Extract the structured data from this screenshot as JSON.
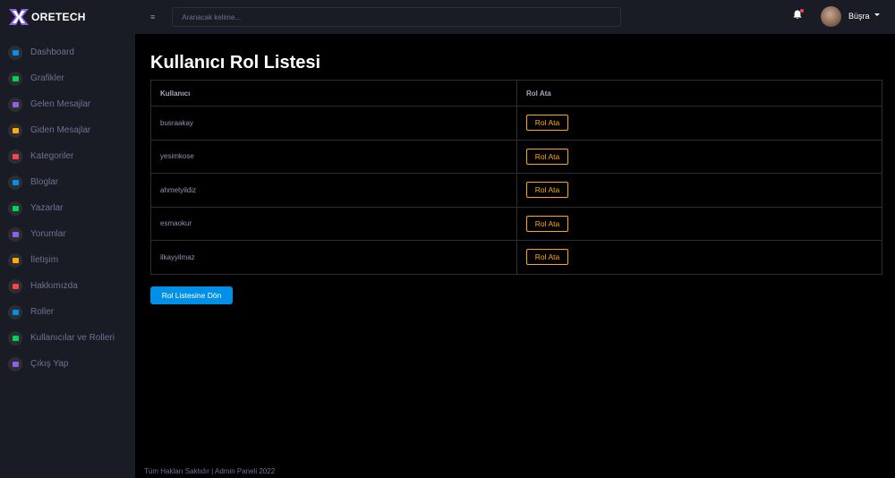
{
  "brand": {
    "name": "ORETECH"
  },
  "colors": {
    "sidebar_bg": "#191c24",
    "main_bg": "#000000",
    "accent_warning": "#ffab00",
    "primary": "#0090e7",
    "text_muted": "#6c7293"
  },
  "sidebar": {
    "items": [
      {
        "label": "Dashboard",
        "icon": "speedometer-icon",
        "color": "#0090e7"
      },
      {
        "label": "Grafikler",
        "icon": "chart-icon",
        "color": "#00d25b"
      },
      {
        "label": "Gelen Mesajlar",
        "icon": "inbox-icon",
        "color": "#8f5fe8"
      },
      {
        "label": "Giden Mesajlar",
        "icon": "send-icon",
        "color": "#ffab00"
      },
      {
        "label": "Kategoriler",
        "icon": "category-icon",
        "color": "#fc424a"
      },
      {
        "label": "Bloglar",
        "icon": "blog-icon",
        "color": "#0090e7"
      },
      {
        "label": "Yazarlar",
        "icon": "users-icon",
        "color": "#00d25b"
      },
      {
        "label": "Yorumlar",
        "icon": "comment-icon",
        "color": "#8f5fe8"
      },
      {
        "label": "İletişim",
        "icon": "contact-icon",
        "color": "#ffab00"
      },
      {
        "label": "Hakkımızda",
        "icon": "about-icon",
        "color": "#fc424a"
      },
      {
        "label": "Roller",
        "icon": "role-icon",
        "color": "#0090e7"
      },
      {
        "label": "Kullanıcılar ve Rolleri",
        "icon": "user-roles-icon",
        "color": "#00d25b"
      },
      {
        "label": "Çıkış Yap",
        "icon": "logout-icon",
        "color": "#8f5fe8"
      }
    ]
  },
  "topbar": {
    "search_placeholder": "Aranacak kelime...",
    "user_name": "Büşra"
  },
  "main": {
    "title": "Kullanıcı Rol Listesi",
    "table": {
      "headers": [
        "Kullanıcı",
        "Rol Ata"
      ],
      "rows": [
        {
          "user": "busraakay",
          "action": "Rol Ata"
        },
        {
          "user": "yesimkose",
          "action": "Rol Ata"
        },
        {
          "user": "ahmetyildiz",
          "action": "Rol Ata"
        },
        {
          "user": "esmaokur",
          "action": "Rol Ata"
        },
        {
          "user": "ilkayyilmaz",
          "action": "Rol Ata"
        }
      ]
    },
    "back_button": "Rol Listesine Dön"
  },
  "footer": {
    "text": "Tüm Hakları Saklıdır | Admin Paneli 2022"
  }
}
